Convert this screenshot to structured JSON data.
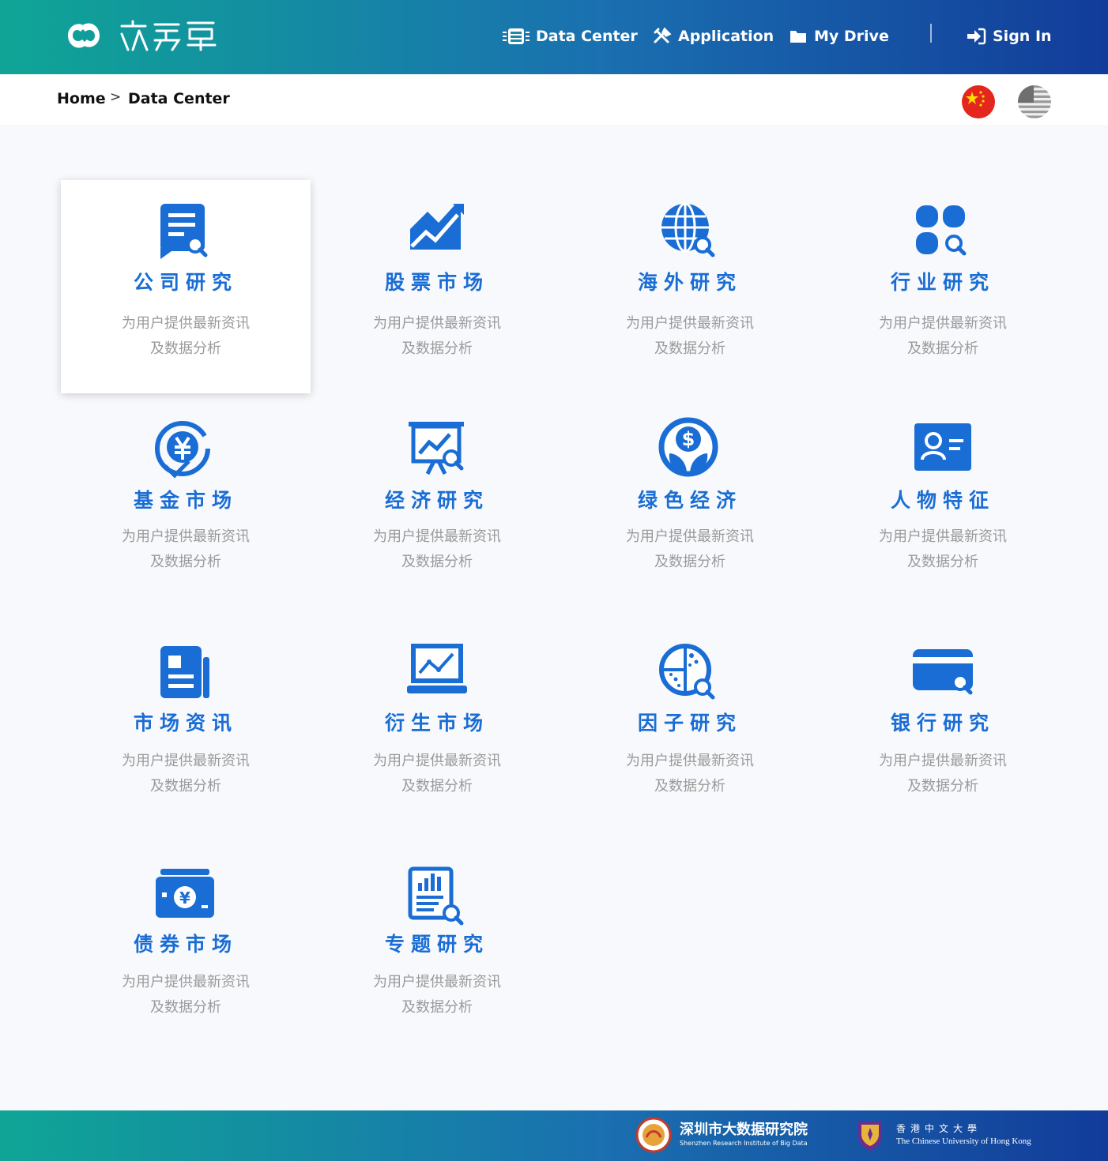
{
  "header": {
    "logo_icon": "brand-logo",
    "nav": [
      {
        "label": "Data Center",
        "icon": "database-icon"
      },
      {
        "label": "Application",
        "icon": "tools-icon"
      },
      {
        "label": "My Drive",
        "icon": "folder-icon"
      }
    ],
    "signin_label": "Sign In"
  },
  "breadcrumb": {
    "home": "Home",
    "separator": ">",
    "current": "Data Center"
  },
  "languages": [
    "china-flag-icon",
    "usa-flag-icon"
  ],
  "colors": {
    "accent": "#1a6dd4",
    "header_start": "#0fa596",
    "header_end": "#123c9a",
    "desc": "#9a9a9a"
  },
  "cards": [
    {
      "title": "公司研究",
      "line1": "为用户提供最新资讯",
      "line2": "及数据分析",
      "icon": "company-report-icon"
    },
    {
      "title": "股票市场",
      "line1": "为用户提供最新资讯",
      "line2": "及数据分析",
      "icon": "stock-chart-icon"
    },
    {
      "title": "海外研究",
      "line1": "为用户提供最新资讯",
      "line2": "及数据分析",
      "icon": "globe-search-icon"
    },
    {
      "title": "行业研究",
      "line1": "为用户提供最新资讯",
      "line2": "及数据分析",
      "icon": "industry-grid-icon"
    },
    {
      "title": "基金市场",
      "line1": "为用户提供最新资讯",
      "line2": "及数据分析",
      "icon": "yen-fund-icon"
    },
    {
      "title": "经济研究",
      "line1": "为用户提供最新资讯",
      "line2": "及数据分析",
      "icon": "presentation-chart-icon"
    },
    {
      "title": "绿色经济",
      "line1": "为用户提供最新资讯",
      "line2": "及数据分析",
      "icon": "green-dollar-icon"
    },
    {
      "title": "人物特征",
      "line1": "为用户提供最新资讯",
      "line2": "及数据分析",
      "icon": "person-card-icon"
    },
    {
      "title": "市场资讯",
      "line1": "为用户提供最新资讯",
      "line2": "及数据分析",
      "icon": "newspaper-icon"
    },
    {
      "title": "衍生市场",
      "line1": "为用户提供最新资讯",
      "line2": "及数据分析",
      "icon": "laptop-chart-icon"
    },
    {
      "title": "因子研究",
      "line1": "为用户提供最新资讯",
      "line2": "及数据分析",
      "icon": "scatter-search-icon"
    },
    {
      "title": "银行研究",
      "line1": "为用户提供最新资讯",
      "line2": "及数据分析",
      "icon": "bank-card-icon"
    },
    {
      "title": "债券市场",
      "line1": "为用户提供最新资讯",
      "line2": "及数据分析",
      "icon": "bond-cash-icon"
    },
    {
      "title": "专题研究",
      "line1": "为用户提供最新资讯",
      "line2": "及数据分析",
      "icon": "topic-report-icon"
    }
  ],
  "footer": {
    "sribd_name": "深圳市大数据研究院",
    "sribd_sub": "Shenzhen Research Institute of Big Data",
    "cuhk_name": "香港中文大學",
    "cuhk_sub": "The Chinese University of Hong Kong"
  }
}
